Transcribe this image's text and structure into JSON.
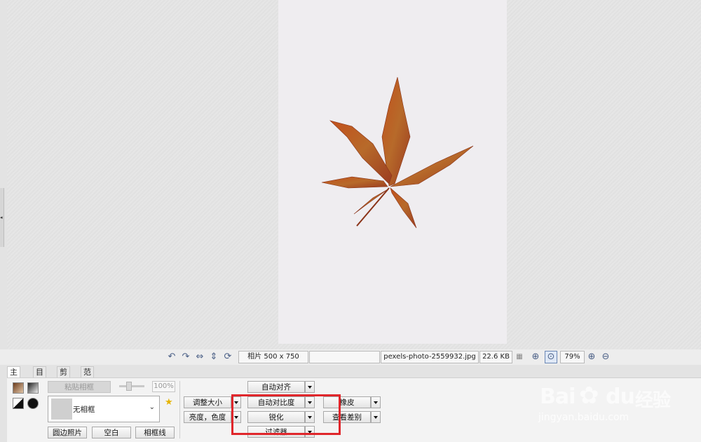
{
  "canvas": {
    "photo_description": "maple-leaf"
  },
  "statusbar": {
    "photo_size": "相片 500 x 750",
    "filename": "pexels-photo-2559932.jpg",
    "filesize": "22.6 KB",
    "zoom": "79%"
  },
  "tabs": [
    "主页",
    "目标",
    "剪切",
    "范围"
  ],
  "ribbon": {
    "paste_frame": "粘贴相框",
    "opacity": "100%",
    "frame_select": "无相框",
    "round_photo": "圆边照片",
    "blank": "空白",
    "frame_line": "相框线",
    "resize": "调整大小",
    "brightness": "亮度，色度",
    "auto_align": "自动对齐",
    "auto_contrast": "自动对比度",
    "sharpen": "锐化",
    "filter": "过滤器",
    "right_top": "橡皮",
    "right_bottom": "查看差别"
  },
  "watermark": {
    "brand": "Bai",
    "brand2": "du",
    "brand3": "经验",
    "url": "jingyan.baidu.com"
  },
  "colors": {
    "highlight": "#e0262b",
    "accent": "#4a5f86"
  }
}
